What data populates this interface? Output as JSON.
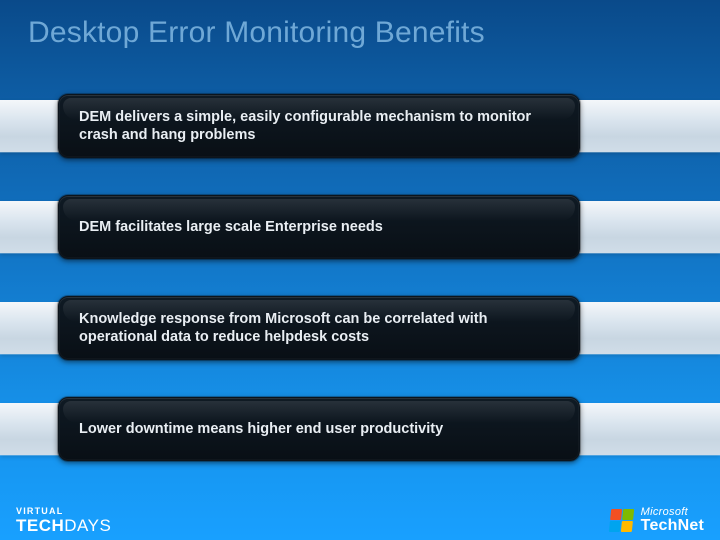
{
  "title": "Desktop Error Monitoring Benefits",
  "bullets": [
    "DEM delivers a simple, easily configurable mechanism to monitor crash and hang problems",
    "DEM facilitates large scale Enterprise needs",
    "Knowledge response from Microsoft can be correlated with operational data to reduce helpdesk costs",
    "Lower downtime means higher end user productivity"
  ],
  "footer": {
    "left_line1": "VIRTUAL",
    "left_line2a": "TECH",
    "left_line2b": "DAYS",
    "right_line1": "Microsoft",
    "right_line2": "TechNet"
  },
  "colors": {
    "flag_tl": "#f25022",
    "flag_tr": "#7fba00",
    "flag_bl": "#00a4ef",
    "flag_br": "#ffb900"
  }
}
